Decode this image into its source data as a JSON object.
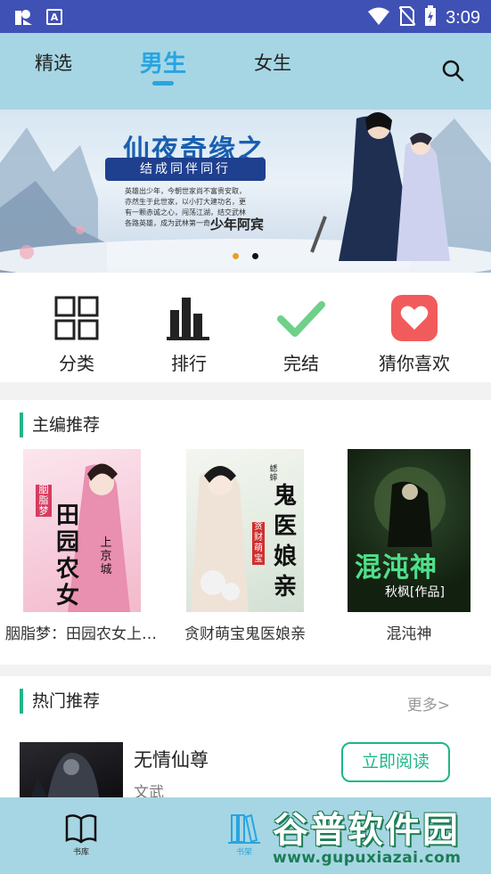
{
  "status_bar": {
    "time": "3:09",
    "left_icons": [
      "app-notification-icon",
      "a-notification-icon"
    ],
    "right_icons": [
      "wifi-icon",
      "no-sim-icon",
      "battery-charging-icon"
    ]
  },
  "header": {
    "tabs": [
      {
        "label": "精选",
        "active": false
      },
      {
        "label": "男生",
        "active": true
      },
      {
        "label": "女生",
        "active": false
      }
    ],
    "search_icon": "search-icon"
  },
  "banner": {
    "title": "仙夜奇缘之",
    "subtitle": "结成同伴同行",
    "description": "英雄出少年，今朝世家尚不富贵安取，亦然生于此世家，以小打大建功名，更有一颗赤诚之心，闯荡江湖，结交武林各路英雄，成为武林第一奇人……",
    "signature": "少年阿宾",
    "dots": 2,
    "active_dot": 0
  },
  "quick_entries": [
    {
      "label": "分类",
      "icon": "grid-icon"
    },
    {
      "label": "排行",
      "icon": "bar-chart-icon"
    },
    {
      "label": "完结",
      "icon": "check-icon"
    },
    {
      "label": "猜你喜欢",
      "icon": "heart-icon"
    }
  ],
  "editor_picks": {
    "heading": "主编推荐",
    "books": [
      {
        "title": "胭脂梦：田园农女上京城",
        "cover_text": "田园农女",
        "cover_sub": "上京城",
        "author_mark": "胭脂梦"
      },
      {
        "title": "贪财萌宝鬼医娘亲",
        "cover_text": "鬼医娘亲",
        "cover_sub": "贪财萌宝",
        "author_mark": "蟋蟀"
      },
      {
        "title": "混沌神",
        "cover_text": "混沌神",
        "cover_sub": "秋枫[作品]",
        "author_mark": ""
      }
    ]
  },
  "hot_picks": {
    "heading": "热门推荐",
    "more": "更多>",
    "items": [
      {
        "title": "无情仙尊",
        "tag": "文武",
        "button": "立即阅读"
      }
    ]
  },
  "bottom_nav": [
    {
      "label": "书库",
      "icon": "book-open-icon",
      "active": false
    },
    {
      "label": "书架",
      "icon": "bookshelf-icon",
      "active": true
    }
  ],
  "watermark": {
    "name": "谷普软件园",
    "url": "www.gupuxiazai.com"
  },
  "colors": {
    "status_bar": "#3f51b5",
    "header_bg": "#a6d6e3",
    "accent_blue": "#29a4e0",
    "accent_green": "#1fb58a",
    "heart_red": "#f25b5b"
  }
}
